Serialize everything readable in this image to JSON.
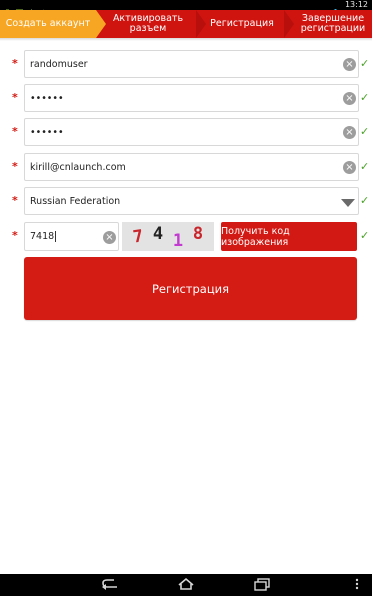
{
  "statusbar": {
    "time": "13:12",
    "icons": [
      "android-icon",
      "image-icon",
      "download-icon",
      "warning-icon",
      "wifi-icon",
      "battery-icon"
    ]
  },
  "steps": {
    "items": [
      {
        "label": "Создать аккаунт",
        "active": true
      },
      {
        "label": "Активировать разъем",
        "active": false
      },
      {
        "label": "Регистрация",
        "active": false
      },
      {
        "label": "Завершение регистрации",
        "active": false
      }
    ]
  },
  "form": {
    "required_mark": "*",
    "check_mark": "✓",
    "username": {
      "value": "randomuser"
    },
    "password": {
      "value": "••••••"
    },
    "password_confirm": {
      "value": "••••••"
    },
    "email": {
      "value": "kirill@cnlaunch.com"
    },
    "country": {
      "value": "Russian Federation"
    },
    "captcha": {
      "value": "7418",
      "image_digits": [
        "7",
        "4",
        "1",
        "8"
      ],
      "digit_colors": [
        "#c8262c",
        "#222222",
        "#c23ad0",
        "#c8262c"
      ],
      "get_code_label": "Получить код изображения"
    },
    "register_label": "Регистрация"
  },
  "colors": {
    "brand_red": "#d21913",
    "active_step": "#f7a623",
    "valid_green": "#4aa329"
  },
  "navbar": {
    "icons": [
      "back-icon",
      "home-icon",
      "recent-apps-icon",
      "menu-icon"
    ]
  }
}
